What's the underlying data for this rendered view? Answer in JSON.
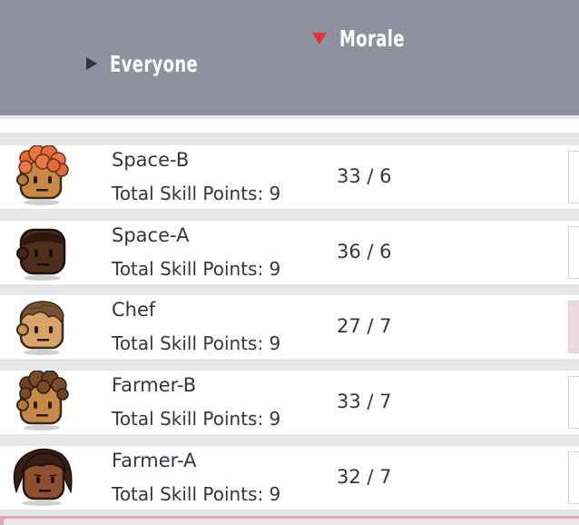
{
  "header": {
    "filter_label": "Everyone",
    "sort_label": "Morale",
    "colors": {
      "background": "#8e929e",
      "sort_arrow": "#e5322e",
      "filter_arrow": "#2f3344"
    }
  },
  "rows": [
    {
      "name": "Space-B",
      "skill_points": "Total Skill Points: 9",
      "morale": "33 / 6",
      "hair": "orange-curly",
      "skin": "tan",
      "highlighted": false
    },
    {
      "name": "Space-A",
      "skill_points": "Total Skill Points: 9",
      "morale": "36 / 6",
      "hair": "bald",
      "skin": "dark-brown",
      "highlighted": false
    },
    {
      "name": "Chef",
      "skill_points": "Total Skill Points: 9",
      "morale": "27 / 7",
      "hair": "short-brown",
      "skin": "tan",
      "highlighted": true
    },
    {
      "name": "Farmer-B",
      "skill_points": "Total Skill Points: 9",
      "morale": "33 / 7",
      "hair": "brown-curly",
      "skin": "tan",
      "highlighted": false
    },
    {
      "name": "Farmer-A",
      "skill_points": "Total Skill Points: 9",
      "morale": "32 / 7",
      "hair": "long-dark",
      "skin": "brown",
      "highlighted": false
    }
  ]
}
